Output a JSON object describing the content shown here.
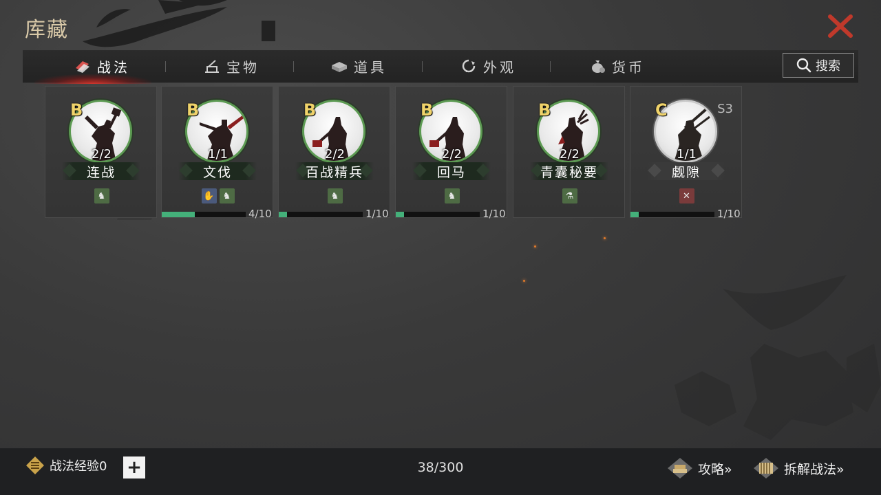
{
  "header": {
    "title": "库藏"
  },
  "tabs": [
    {
      "label": "战法",
      "icon": "skill-scroll-icon",
      "active": true
    },
    {
      "label": "宝物",
      "icon": "treasure-icon",
      "active": false
    },
    {
      "label": "道具",
      "icon": "item-box-icon",
      "active": false
    },
    {
      "label": "外观",
      "icon": "appearance-icon",
      "active": false
    },
    {
      "label": "货币",
      "icon": "currency-bag-icon",
      "active": false
    }
  ],
  "search": {
    "label": "搜索"
  },
  "cards": [
    {
      "grade": "B",
      "count": "2/2",
      "name": "连战",
      "season": "",
      "tags": [
        "green"
      ],
      "progress": null,
      "progress_label": ""
    },
    {
      "grade": "B",
      "count": "1/1",
      "name": "文伐",
      "season": "",
      "tags": [
        "blue",
        "green"
      ],
      "progress": 0.4,
      "progress_label": "4/10"
    },
    {
      "grade": "B",
      "count": "2/2",
      "name": "百战精兵",
      "season": "",
      "tags": [
        "green"
      ],
      "progress": 0.1,
      "progress_label": "1/10"
    },
    {
      "grade": "B",
      "count": "2/2",
      "name": "回马",
      "season": "",
      "tags": [
        "green"
      ],
      "progress": 0.1,
      "progress_label": "1/10"
    },
    {
      "grade": "B",
      "count": "2/2",
      "name": "青囊秘要",
      "season": "",
      "tags": [
        "green"
      ],
      "progress": null,
      "progress_label": ""
    },
    {
      "grade": "C",
      "count": "1/1",
      "name": "觑隙",
      "season": "S3",
      "tags": [
        "red"
      ],
      "progress": 0.1,
      "progress_label": "1/10"
    }
  ],
  "footer": {
    "exp_label": "战法经验0",
    "plus_label": "+",
    "capacity": "38/300",
    "guide_label": "攻略»",
    "dismantle_label": "拆解战法»"
  },
  "colors": {
    "accent_green": "#44b07a",
    "grade_gold": "#f0d36a",
    "close_red": "#c0392b"
  }
}
